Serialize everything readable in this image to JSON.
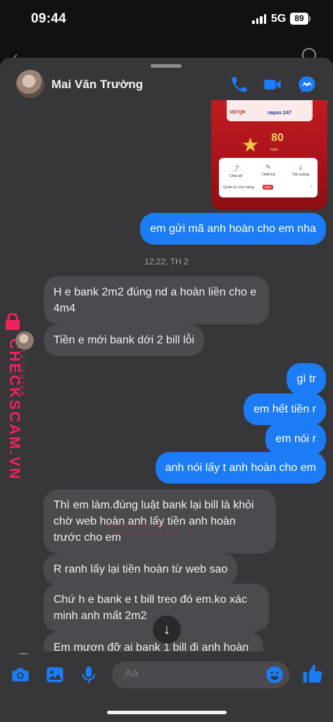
{
  "status": {
    "time": "09:44",
    "network": "5G",
    "battery": "89"
  },
  "contact": {
    "name": "Mai Văn Trường"
  },
  "header_icons": [
    "phone-icon",
    "video-call-icon",
    "messenger-icon"
  ],
  "shared_image": {
    "bank_logo": "VIETQR",
    "partner_logo": "napas 247",
    "anniversary": "80",
    "anniversary_unit": "NĂM",
    "actions": [
      "Chia sẻ",
      "Thiết kế",
      "Tải xuống"
    ],
    "store_label": "Quản lý cửa hàng",
    "badge": "MỚI"
  },
  "messages": [
    {
      "dir": "out",
      "text": "em gửi mã anh hoàn cho em nha"
    },
    {
      "dir": "time",
      "text": "12:22, TH 2"
    },
    {
      "dir": "in",
      "text": "H e bank 2m2 đúng nd a hoàn liền cho e 4m4"
    },
    {
      "dir": "in",
      "text": "Tiền e mới bank dới 2 bill lỗi"
    },
    {
      "dir": "out",
      "text": "gì tr"
    },
    {
      "dir": "out",
      "text": "em hết tiền r"
    },
    {
      "dir": "out",
      "text": "em nói r"
    },
    {
      "dir": "out",
      "text": "anh nói lấy t anh hoàn cho em"
    },
    {
      "dir": "in",
      "text": "Thì em làm.đúng luật bank lại bill là khỏi chờ web hoàn anh lấy tiền anh hoàn trước cho em"
    },
    {
      "dir": "in",
      "text": "R ranh lấy lại tiền hoàn từ web sao"
    },
    {
      "dir": "in",
      "text": "Chứ h e bank e t bill treo đó em.ko xác minh anh mất 2m2"
    },
    {
      "dir": "in",
      "text": "Em mượn đỡ ai bank 1 bill đi anh hoàn"
    }
  ],
  "watermark": {
    "main": "CHECKSCAM.VN",
    "sub": "DATA CENTER"
  },
  "composer": {
    "placeholder": "Aa"
  },
  "composer_icons": [
    "camera-icon",
    "gallery-icon",
    "microphone-icon",
    "emoji-icon",
    "thumbs-up-icon"
  ],
  "colors": {
    "accent": "#1b7cf6",
    "incoming": "#4b4b4f",
    "sheet": "#373739",
    "watermark": "#f2235b"
  }
}
